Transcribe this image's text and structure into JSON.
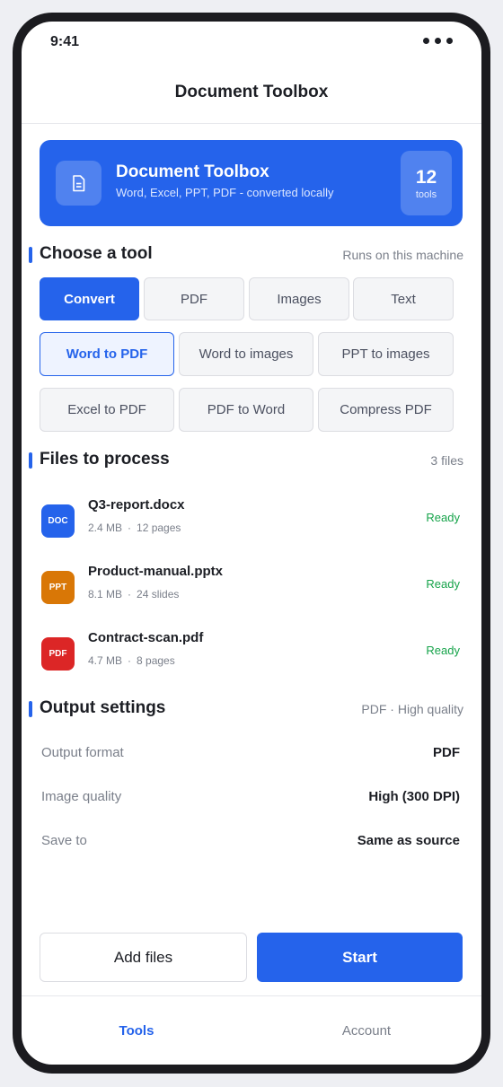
{
  "status_bar": {
    "time": "9:41"
  },
  "nav": {
    "title": "Document Toolbox"
  },
  "hero": {
    "title": "Document Toolbox",
    "subtitle": "Word, Excel, PPT, PDF - converted locally",
    "count": "12",
    "count_unit": "tools",
    "icon": "document-icon"
  },
  "tools_section": {
    "title": "Choose a tool",
    "meta": "Runs on this machine",
    "categories": [
      "Convert",
      "PDF",
      "Images",
      "Text"
    ],
    "active_category": "Convert",
    "tools": [
      "Word to PDF",
      "Word to images",
      "PPT to images",
      "Excel to PDF",
      "PDF to Word",
      "Compress PDF"
    ],
    "selected_tool": "Word to PDF"
  },
  "files_section": {
    "title": "Files to process",
    "meta": "3 files",
    "files": [
      {
        "badge": "DOC",
        "badge_color": "#2563eb",
        "name": "Q3-report.docx",
        "size": "2.4 MB",
        "detail": "12 pages",
        "status": "Ready"
      },
      {
        "badge": "PPT",
        "badge_color": "#d97706",
        "name": "Product-manual.pptx",
        "size": "8.1 MB",
        "detail": "24 slides",
        "status": "Ready"
      },
      {
        "badge": "PDF",
        "badge_color": "#dc2626",
        "name": "Contract-scan.pdf",
        "size": "4.7 MB",
        "detail": "8 pages",
        "status": "Ready"
      }
    ]
  },
  "output_section": {
    "title": "Output settings",
    "meta": "PDF · High quality",
    "settings": [
      {
        "label": "Output format",
        "value": "PDF"
      },
      {
        "label": "Image quality",
        "value": "High (300 DPI)"
      },
      {
        "label": "Save to",
        "value": "Same as source"
      }
    ]
  },
  "actions": {
    "add_files": "Add files",
    "start": "Start"
  },
  "tab_bar": {
    "tools": "Tools",
    "account": "Account",
    "active": "Tools"
  },
  "colors": {
    "accent": "#2563eb",
    "ready": "#16a34a"
  }
}
